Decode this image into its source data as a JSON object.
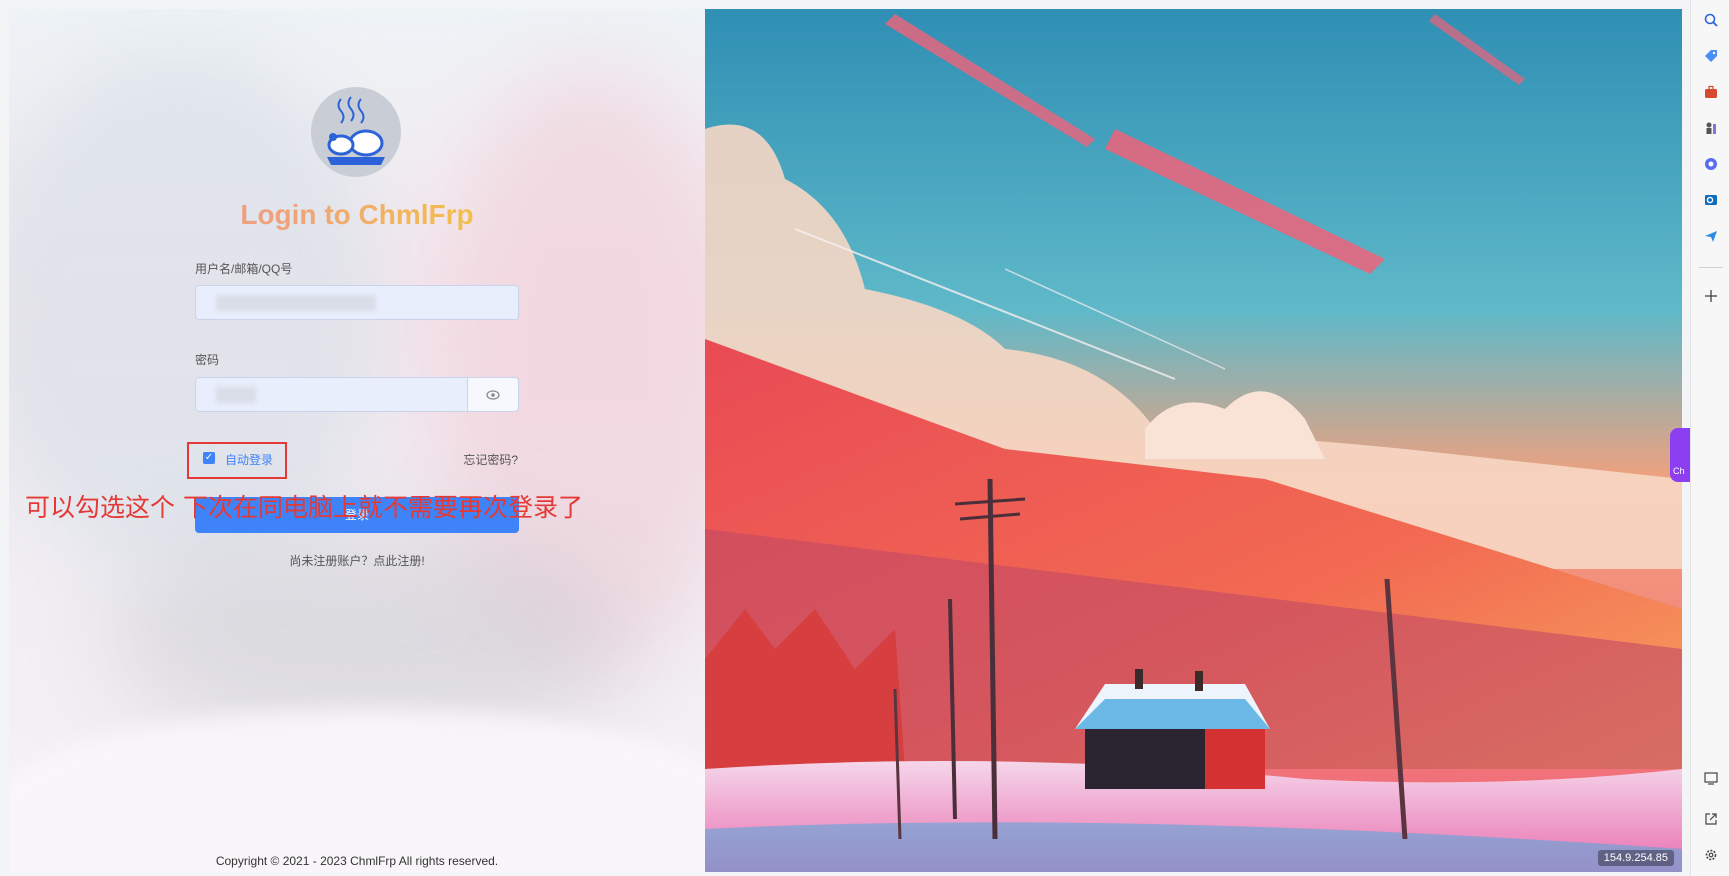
{
  "login": {
    "title": "Login to ChmlFrp",
    "username_label": "用户名/邮箱/QQ号",
    "password_label": "密码",
    "auto_login_label": "自动登录",
    "auto_login_checked": true,
    "forgot_password": "忘记密码?",
    "login_button": "登录",
    "register_link": "尚未注册账户？点此注册!",
    "copyright": "Copyright © 2021 - 2023 ChmlFrp All rights reserved."
  },
  "annotation": {
    "text": "可以勾选这个 下次在同电脑上就不需要再次登录了",
    "color": "#e53935"
  },
  "background_image": {
    "ip_label": "154.9.254.85"
  },
  "edge_tab": {
    "label": "Ch"
  },
  "sidebar": {
    "icons": [
      "search-icon",
      "tag-icon",
      "toolbox-icon",
      "chess-icon",
      "copilot-icon",
      "outlook-icon",
      "send-icon",
      "plus-icon",
      "screenshot-icon",
      "external-link-icon",
      "gear-icon"
    ]
  },
  "colors": {
    "accent": "#3f83f8",
    "annotation": "#e53935"
  }
}
